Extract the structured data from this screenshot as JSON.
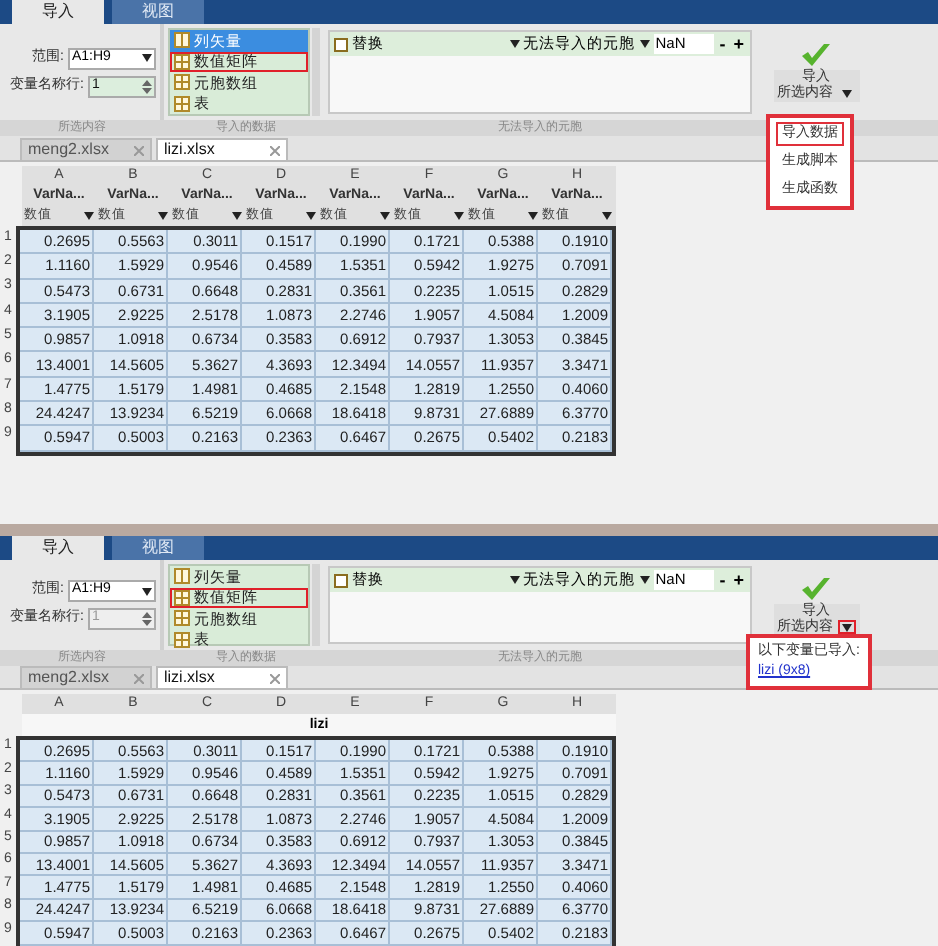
{
  "screens": [
    {
      "tabs": [
        {
          "label": "导入",
          "selected": true
        },
        {
          "label": "视图",
          "selected": false
        }
      ],
      "selection": {
        "range_label": "范围:",
        "range": "A1:H9",
        "varrow_label": "变量名称行:",
        "varrow": "1",
        "varrow_disabled": false
      },
      "output_types": [
        {
          "label": "列矢量",
          "selected": true,
          "annotated": false
        },
        {
          "label": "数值矩阵",
          "selected": false,
          "annotated": true
        },
        {
          "label": "元胞数组",
          "selected": false,
          "annotated": false
        },
        {
          "label": "表",
          "selected": false,
          "annotated": false
        }
      ],
      "unimportable": {
        "replace_label": "替换",
        "replace_checked": false,
        "dropdown": "无法导入的元胞",
        "value": "NaN",
        "minus": "-",
        "plus": "+"
      },
      "import": {
        "line1": "导入",
        "line2": "所选内容",
        "arrow_annotated": false
      },
      "section_labels": [
        "所选内容",
        "导入的数据",
        "无法导入的元胞"
      ],
      "files": [
        {
          "label": "meng2.xlsx",
          "selected": false
        },
        {
          "label": "lizi.xlsx",
          "selected": true
        }
      ],
      "grid": {
        "columns": [
          "A",
          "B",
          "C",
          "D",
          "E",
          "F",
          "G",
          "H"
        ],
        "var_names": [
          "VarNa...",
          "VarNa...",
          "VarNa...",
          "VarNa...",
          "VarNa...",
          "VarNa...",
          "VarNa...",
          "VarNa..."
        ],
        "types": [
          "数值",
          "数值",
          "数值",
          "数值",
          "数值",
          "数值",
          "数值",
          "数值"
        ],
        "rows": [
          {
            "num": "1",
            "cells": [
              "0.2695",
              "0.5563",
              "0.3011",
              "0.1517",
              "0.1990",
              "0.1721",
              "0.5388",
              "0.1910"
            ]
          },
          {
            "num": "2",
            "cells": [
              "1.1160",
              "1.5929",
              "0.9546",
              "0.4589",
              "1.5351",
              "0.5942",
              "1.9275",
              "0.7091"
            ]
          },
          {
            "num": "3",
            "cells": [
              "0.5473",
              "0.6731",
              "0.6648",
              "0.2831",
              "0.3561",
              "0.2235",
              "1.0515",
              "0.2829"
            ]
          },
          {
            "num": "4",
            "cells": [
              "3.1905",
              "2.9225",
              "2.5178",
              "1.0873",
              "2.2746",
              "1.9057",
              "4.5084",
              "1.2009"
            ]
          },
          {
            "num": "5",
            "cells": [
              "0.9857",
              "1.0918",
              "0.6734",
              "0.3583",
              "0.6912",
              "0.7937",
              "1.3053",
              "0.3845"
            ]
          },
          {
            "num": "6",
            "cells": [
              "13.4001",
              "14.5605",
              "5.3627",
              "4.3693",
              "12.3494",
              "14.0557",
              "11.9357",
              "3.3471"
            ]
          },
          {
            "num": "7",
            "cells": [
              "1.4775",
              "1.5179",
              "1.4981",
              "0.4685",
              "2.1548",
              "1.2819",
              "1.2550",
              "0.4060"
            ]
          },
          {
            "num": "8",
            "cells": [
              "24.4247",
              "13.9234",
              "6.5219",
              "6.0668",
              "18.6418",
              "9.8731",
              "27.6889",
              "6.3770"
            ]
          },
          {
            "num": "9",
            "cells": [
              "0.5947",
              "0.5003",
              "0.2163",
              "0.2363",
              "0.6467",
              "0.2675",
              "0.5402",
              "0.2183"
            ]
          }
        ]
      },
      "menu": {
        "kind": "actions",
        "annotated": true,
        "items": [
          {
            "label": "导入数据",
            "annotated": true
          },
          {
            "label": "生成脚本",
            "annotated": false
          },
          {
            "label": "生成函数",
            "annotated": false
          }
        ]
      }
    },
    {
      "tabs": [
        {
          "label": "导入",
          "selected": true
        },
        {
          "label": "视图",
          "selected": false
        }
      ],
      "selection": {
        "range_label": "范围:",
        "range": "A1:H9",
        "varrow_label": "变量名称行:",
        "varrow": "1",
        "varrow_disabled": true
      },
      "output_types": [
        {
          "label": "列矢量",
          "selected": false,
          "annotated": false
        },
        {
          "label": "数值矩阵",
          "selected": false,
          "annotated": true
        },
        {
          "label": "元胞数组",
          "selected": false,
          "annotated": false
        },
        {
          "label": "表",
          "selected": false,
          "annotated": false
        }
      ],
      "unimportable": {
        "replace_label": "替换",
        "replace_checked": false,
        "dropdown": "无法导入的元胞",
        "value": "NaN",
        "minus": "-",
        "plus": "+"
      },
      "import": {
        "line1": "导入",
        "line2": "所选内容",
        "arrow_annotated": true
      },
      "section_labels": [
        "所选内容",
        "导入的数据",
        "无法导入的元胞"
      ],
      "files": [
        {
          "label": "meng2.xlsx",
          "selected": false
        },
        {
          "label": "lizi.xlsx",
          "selected": true
        }
      ],
      "grid": {
        "columns": [
          "A",
          "B",
          "C",
          "D",
          "E",
          "F",
          "G",
          "H"
        ],
        "title": "lizi",
        "rows": [
          {
            "num": "1",
            "cells": [
              "0.2695",
              "0.5563",
              "0.3011",
              "0.1517",
              "0.1990",
              "0.1721",
              "0.5388",
              "0.1910"
            ]
          },
          {
            "num": "2",
            "cells": [
              "1.1160",
              "1.5929",
              "0.9546",
              "0.4589",
              "1.5351",
              "0.5942",
              "1.9275",
              "0.7091"
            ]
          },
          {
            "num": "3",
            "cells": [
              "0.5473",
              "0.6731",
              "0.6648",
              "0.2831",
              "0.3561",
              "0.2235",
              "1.0515",
              "0.2829"
            ]
          },
          {
            "num": "4",
            "cells": [
              "3.1905",
              "2.9225",
              "2.5178",
              "1.0873",
              "2.2746",
              "1.9057",
              "4.5084",
              "1.2009"
            ]
          },
          {
            "num": "5",
            "cells": [
              "0.9857",
              "1.0918",
              "0.6734",
              "0.3583",
              "0.6912",
              "0.7937",
              "1.3053",
              "0.3845"
            ]
          },
          {
            "num": "6",
            "cells": [
              "13.4001",
              "14.5605",
              "5.3627",
              "4.3693",
              "12.3494",
              "14.0557",
              "11.9357",
              "3.3471"
            ]
          },
          {
            "num": "7",
            "cells": [
              "1.4775",
              "1.5179",
              "1.4981",
              "0.4685",
              "2.1548",
              "1.2819",
              "1.2550",
              "0.4060"
            ]
          },
          {
            "num": "8",
            "cells": [
              "24.4247",
              "13.9234",
              "6.5219",
              "6.0668",
              "18.6418",
              "9.8731",
              "27.6889",
              "6.3770"
            ]
          },
          {
            "num": "9",
            "cells": [
              "0.5947",
              "0.5003",
              "0.2163",
              "0.2363",
              "0.6467",
              "0.2675",
              "0.5402",
              "0.2183"
            ]
          }
        ]
      },
      "menu": {
        "kind": "imported",
        "annotated": true,
        "heading": "以下变量已导入:",
        "link": "lizi (9x8)"
      }
    }
  ]
}
